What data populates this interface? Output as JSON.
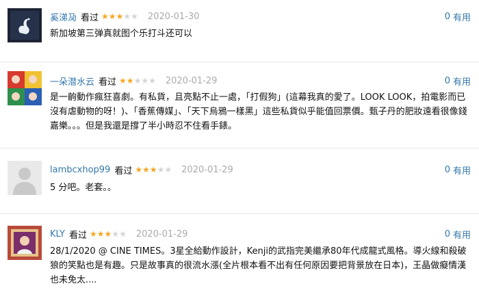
{
  "reviews": [
    {
      "user": "奚涕夃",
      "status": "看过",
      "stars": 3,
      "date": "2020-01-30",
      "votes": "0",
      "vote_label": "有用",
      "text": "新加坡第三弹真就图个乐打斗还可以"
    },
    {
      "user": "一朵潜水云",
      "status": "看过",
      "stars": 2,
      "date": "2020-01-29",
      "votes": "0",
      "vote_label": "有用",
      "text": "是一齣動作瘋狂喜劇。有私貨，且亮點不止一處，「打假狗」(這幕我真的愛了。LOOK LOOK，拍電影而已沒有虐動物的呀！)、「香蕉傳媒」、「天下烏鴉一樣黑」這些私貨似乎能值回票價。甄子丹的肥妝遠看很像錢嘉樂。。。但是我還是撐了半小時忍不住看手錶。"
    },
    {
      "user": "lambcxhop99",
      "status": "看过",
      "stars": 3,
      "date": "2020-01-29",
      "votes": "0",
      "vote_label": "有用",
      "text": "5 分吧。老套。。"
    },
    {
      "user": "KLY",
      "status": "看过",
      "stars": 3,
      "date": "2020-01-29",
      "votes": "0",
      "vote_label": "有用",
      "text": "28/1/2020 @ CINE TIMES。3星全給動作設計，Kenji的武指完美繼承80年代成龍式風格。導火線和殺破狼的笑點也是有趣。只是故事真的很流水漲(全片根本看不出有任何原因要把背景放在日本)，王晶做癡情漢也未免太...."
    }
  ],
  "colors": {
    "link": "#3377aa",
    "star_on": "#f6a623",
    "star_off": "#d4d4d4",
    "date": "#aaaaaa"
  }
}
